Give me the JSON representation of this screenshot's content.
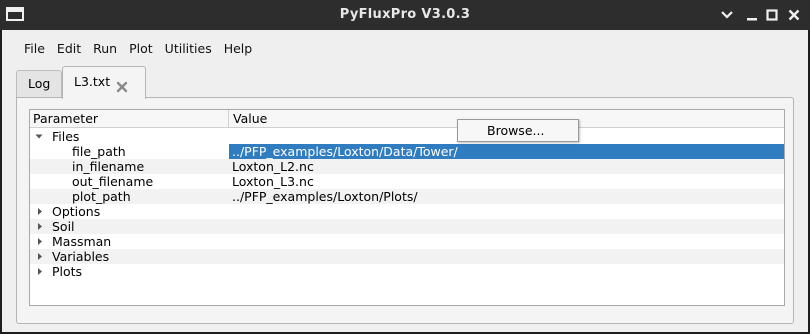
{
  "window": {
    "title": "PyFluxPro V3.0.3"
  },
  "menubar": {
    "items": [
      "File",
      "Edit",
      "Run",
      "Plot",
      "Utilities",
      "Help"
    ]
  },
  "tabs": [
    {
      "label": "Log",
      "active": false
    },
    {
      "label": "L3.txt",
      "active": true,
      "closable": true
    }
  ],
  "tree": {
    "columns": [
      "Parameter",
      "Value"
    ],
    "rows": [
      {
        "param": "Files",
        "value": "",
        "level": 0,
        "expanded": true
      },
      {
        "param": "file_path",
        "value": "../PFP_examples/Loxton/Data/Tower/",
        "level": 2,
        "selected": true
      },
      {
        "param": "in_filename",
        "value": "Loxton_L2.nc",
        "level": 2
      },
      {
        "param": "out_filename",
        "value": "Loxton_L3.nc",
        "level": 2
      },
      {
        "param": "plot_path",
        "value": "../PFP_examples/Loxton/Plots/",
        "level": 2
      },
      {
        "param": "Options",
        "value": "",
        "level": 0,
        "expanded": false
      },
      {
        "param": "Soil",
        "value": "",
        "level": 0,
        "expanded": false
      },
      {
        "param": "Massman",
        "value": "",
        "level": 0,
        "expanded": false
      },
      {
        "param": "Variables",
        "value": "",
        "level": 0,
        "expanded": false
      },
      {
        "param": "Plots",
        "value": "",
        "level": 0,
        "expanded": false
      }
    ]
  },
  "context_menu": {
    "items": [
      "Browse..."
    ]
  },
  "colors": {
    "titlebar": "#2d2d2d",
    "selection": "#2f7cc1",
    "background": "#efefef"
  },
  "icons": {
    "app": "window-icon",
    "minimize": "minimize-icon",
    "maximize": "maximize-icon",
    "close": "close-icon",
    "tab_close": "tab-close-icon",
    "expand": "expand-arrow-icon",
    "collapse": "collapse-arrow-icon"
  }
}
